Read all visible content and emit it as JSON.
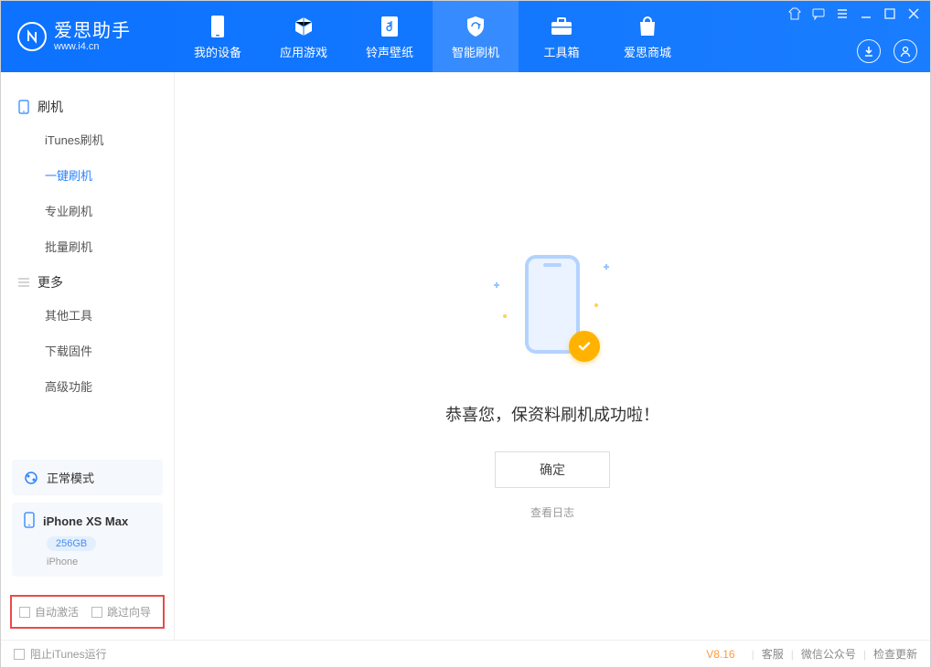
{
  "brand": {
    "name": "爱思助手",
    "url": "www.i4.cn"
  },
  "nav": {
    "tabs": [
      {
        "label": "我的设备",
        "icon": "device-icon"
      },
      {
        "label": "应用游戏",
        "icon": "cube-icon"
      },
      {
        "label": "铃声壁纸",
        "icon": "music-file-icon"
      },
      {
        "label": "智能刷机",
        "icon": "shield-refresh-icon"
      },
      {
        "label": "工具箱",
        "icon": "toolbox-icon"
      },
      {
        "label": "爱思商城",
        "icon": "bag-icon"
      }
    ],
    "active_index": 3
  },
  "sidebar": {
    "groups": [
      {
        "title": "刷机",
        "icon": "phone-icon",
        "items": [
          {
            "label": "iTunes刷机"
          },
          {
            "label": "一键刷机",
            "active": true
          },
          {
            "label": "专业刷机"
          },
          {
            "label": "批量刷机"
          }
        ]
      },
      {
        "title": "更多",
        "icon": "list-icon",
        "items": [
          {
            "label": "其他工具"
          },
          {
            "label": "下载固件"
          },
          {
            "label": "高级功能"
          }
        ]
      }
    ],
    "mode_card": {
      "label": "正常模式",
      "icon": "mode-icon"
    },
    "device": {
      "name": "iPhone XS Max",
      "capacity": "256GB",
      "type": "iPhone"
    },
    "checks": {
      "auto_activate": "自动激活",
      "skip_guide": "跳过向导"
    }
  },
  "main": {
    "success_text": "恭喜您，保资料刷机成功啦！",
    "ok_button": "确定",
    "log_link": "查看日志"
  },
  "footer": {
    "block_itunes": "阻止iTunes运行",
    "version": "V8.16",
    "links": {
      "service": "客服",
      "wechat": "微信公众号",
      "update": "检查更新"
    }
  }
}
